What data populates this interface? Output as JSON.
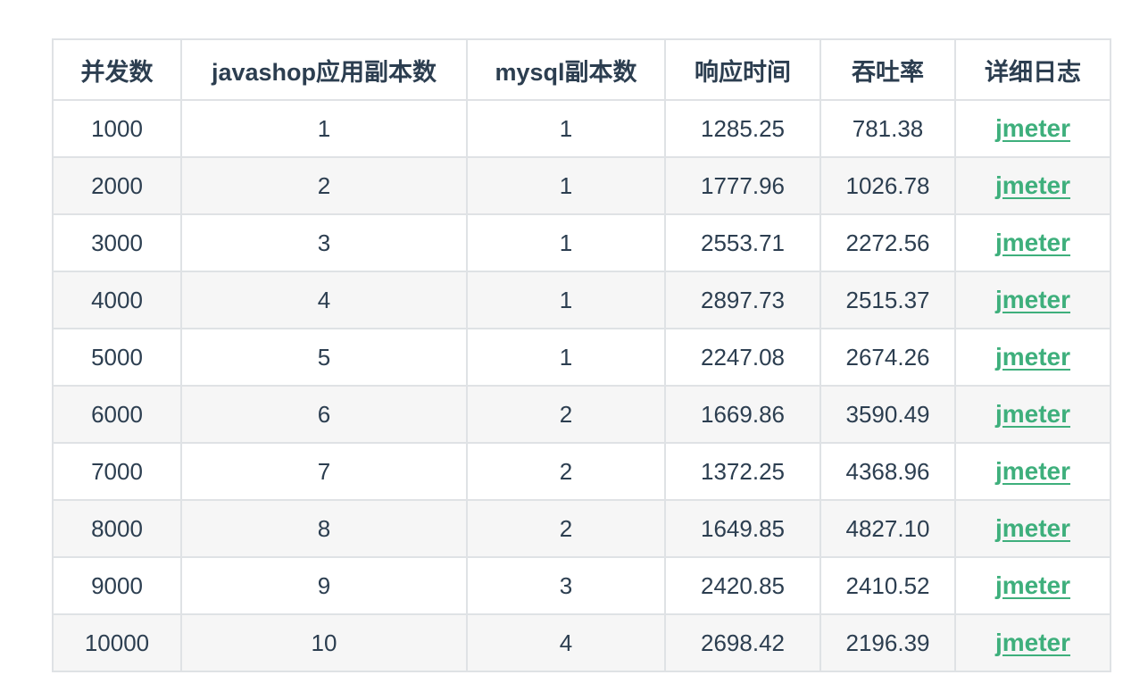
{
  "table": {
    "columns": [
      "并发数",
      "javashop应用副本数",
      "mysql副本数",
      "响应时间",
      "吞吐率",
      "详细日志"
    ],
    "rows": [
      {
        "concurrency": "1000",
        "app_replicas": "1",
        "mysql_replicas": "1",
        "response_time": "1285.25",
        "throughput": "781.38",
        "log": "jmeter"
      },
      {
        "concurrency": "2000",
        "app_replicas": "2",
        "mysql_replicas": "1",
        "response_time": "1777.96",
        "throughput": "1026.78",
        "log": "jmeter"
      },
      {
        "concurrency": "3000",
        "app_replicas": "3",
        "mysql_replicas": "1",
        "response_time": "2553.71",
        "throughput": "2272.56",
        "log": "jmeter"
      },
      {
        "concurrency": "4000",
        "app_replicas": "4",
        "mysql_replicas": "1",
        "response_time": "2897.73",
        "throughput": "2515.37",
        "log": "jmeter"
      },
      {
        "concurrency": "5000",
        "app_replicas": "5",
        "mysql_replicas": "1",
        "response_time": "2247.08",
        "throughput": "2674.26",
        "log": "jmeter"
      },
      {
        "concurrency": "6000",
        "app_replicas": "6",
        "mysql_replicas": "2",
        "response_time": "1669.86",
        "throughput": "3590.49",
        "log": "jmeter"
      },
      {
        "concurrency": "7000",
        "app_replicas": "7",
        "mysql_replicas": "2",
        "response_time": "1372.25",
        "throughput": "4368.96",
        "log": "jmeter"
      },
      {
        "concurrency": "8000",
        "app_replicas": "8",
        "mysql_replicas": "2",
        "response_time": "1649.85",
        "throughput": "4827.10",
        "log": "jmeter"
      },
      {
        "concurrency": "9000",
        "app_replicas": "9",
        "mysql_replicas": "3",
        "response_time": "2420.85",
        "throughput": "2410.52",
        "log": "jmeter"
      },
      {
        "concurrency": "10000",
        "app_replicas": "10",
        "mysql_replicas": "4",
        "response_time": "2698.42",
        "throughput": "2196.39",
        "log": "jmeter"
      }
    ]
  },
  "colors": {
    "text": "#2c3e50",
    "link": "#3eaf7c",
    "border": "#dfe2e5",
    "stripe": "#f6f6f6"
  }
}
